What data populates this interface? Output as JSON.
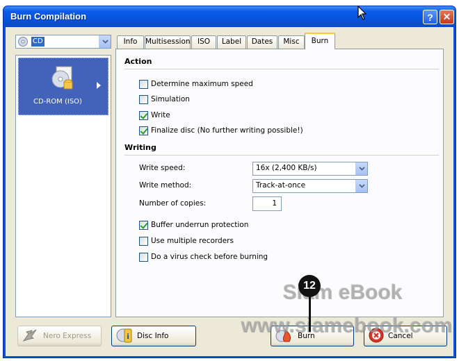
{
  "window": {
    "title": "Burn Compilation",
    "help_label": "?",
    "close_label": "✕"
  },
  "recorder": {
    "selected": "CD",
    "icon": "disc-icon"
  },
  "sidebar": {
    "items": [
      {
        "label": "CD-ROM (ISO)",
        "icon": "cd-rom-iso-icon",
        "selected": true
      }
    ]
  },
  "tabs": [
    {
      "label": "Info"
    },
    {
      "label": "Multisession"
    },
    {
      "label": "ISO"
    },
    {
      "label": "Label"
    },
    {
      "label": "Dates"
    },
    {
      "label": "Misc"
    },
    {
      "label": "Burn",
      "active": true
    }
  ],
  "action": {
    "title": "Action",
    "options": [
      {
        "label": "Determine maximum speed",
        "checked": false
      },
      {
        "label": "Simulation",
        "checked": false
      },
      {
        "label": "Write",
        "checked": true
      },
      {
        "label": "Finalize disc (No further writing possible!)",
        "checked": true
      }
    ]
  },
  "writing": {
    "title": "Writing",
    "speed_label": "Write speed:",
    "speed_value": "16x (2,400 KB/s)",
    "method_label": "Write method:",
    "method_value": "Track-at-once",
    "copies_label": "Number of copies:",
    "copies_value": "1",
    "options": [
      {
        "label": "Buffer underrun protection",
        "checked": true
      },
      {
        "label": "Use multiple recorders",
        "checked": false
      },
      {
        "label": "Do a virus check before burning",
        "checked": false
      }
    ]
  },
  "buttons": {
    "nero_express": "Nero Express",
    "disc_info": "Disc Info",
    "burn": "Burn",
    "cancel": "Cancel"
  },
  "watermark": {
    "line1": "Siam eBook",
    "line2": "www.siamebook.com"
  },
  "callout": {
    "number": "12"
  },
  "colors": {
    "titlebar": "#0752d8",
    "selection": "#4263b9",
    "active_tab_accent": "#ffc83c",
    "check": "#21a121"
  }
}
